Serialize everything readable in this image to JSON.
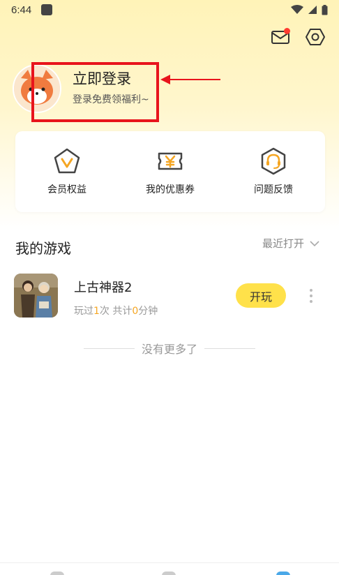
{
  "status_bar": {
    "time": "6:44"
  },
  "profile": {
    "login_title": "立即登录",
    "login_subtitle": "登录免费领福利~"
  },
  "quick_actions": [
    {
      "label": "会员权益",
      "icon": "member-v-icon"
    },
    {
      "label": "我的优惠券",
      "icon": "coupon-yen-icon"
    },
    {
      "label": "问题反馈",
      "icon": "headset-icon"
    }
  ],
  "my_games": {
    "title": "我的游戏",
    "sort_label": "最近打开",
    "items": [
      {
        "name": "上古神器2",
        "stats_prefix": "玩过",
        "play_count": "1",
        "stats_mid": "次 共计",
        "play_minutes": "0",
        "stats_suffix": "分钟",
        "play_label": "开玩"
      }
    ],
    "end_text": "没有更多了"
  },
  "colors": {
    "accent_yellow": "#ffe14a",
    "highlight_orange": "#f5a623",
    "annotation_red": "#e8141c"
  }
}
